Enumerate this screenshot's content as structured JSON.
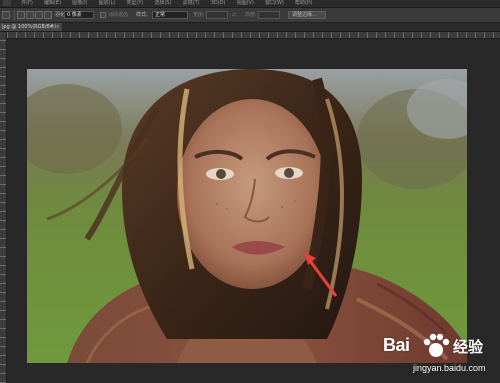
{
  "menu": {
    "items": [
      "件(F)",
      "编辑(E)",
      "图像(I)",
      "图层(L)",
      "类型(Y)",
      "选择(S)",
      "滤镜(T)",
      "3D(D)",
      "视图(V)",
      "窗口(W)",
      "帮助(H)"
    ]
  },
  "options": {
    "feather_value": "0 像素",
    "antialias_label": "消除锯齿",
    "style_label": "样式:",
    "style_value": "正常",
    "width_label": "宽度:",
    "height_label": "高度:",
    "refine_edge_button": "调整边缘..."
  },
  "tab": {
    "title": "jpg @ 100%(RGB/8#)",
    "close": "×"
  },
  "watermark": {
    "brand": "Bai",
    "brand_cn": "经验",
    "url": "jingyan.baidu.com"
  },
  "colors": {
    "arrow": "#e8403a",
    "background": "#282828"
  }
}
